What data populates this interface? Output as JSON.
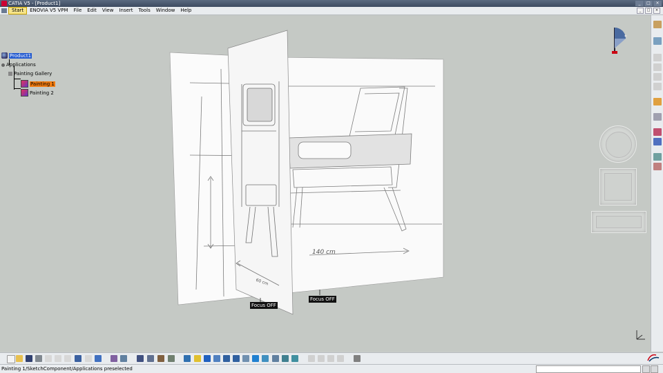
{
  "window": {
    "title": "CATIA V5 - [Product1]",
    "buttons": [
      "_",
      "□",
      "×"
    ]
  },
  "menu": {
    "items": [
      "Start",
      "ENOVIA V5 VPM",
      "File",
      "Edit",
      "View",
      "Insert",
      "Tools",
      "Window",
      "Help"
    ]
  },
  "tree": {
    "root": "Product1",
    "applications": "Applications",
    "gallery": "Painting Gallery",
    "painting1": "Painting 1",
    "painting2": "Painting 2"
  },
  "viewport": {
    "focus_label_1": "Focus OFF",
    "focus_label_2": "Focus OFF",
    "sketch_dimension": "140 cm",
    "sketch_dimension_2": "60 cm"
  },
  "status": {
    "message": "Painting 1/SketchComponent/Applications preselected",
    "command_value": ""
  },
  "icons": {
    "compass": "compass-icon",
    "axis": "axis-triad-icon",
    "logo": "catia-logo"
  },
  "colors": {
    "selection_blue": "#2259d0",
    "selection_orange": "#f07a10",
    "background": "#c5c9c5"
  }
}
